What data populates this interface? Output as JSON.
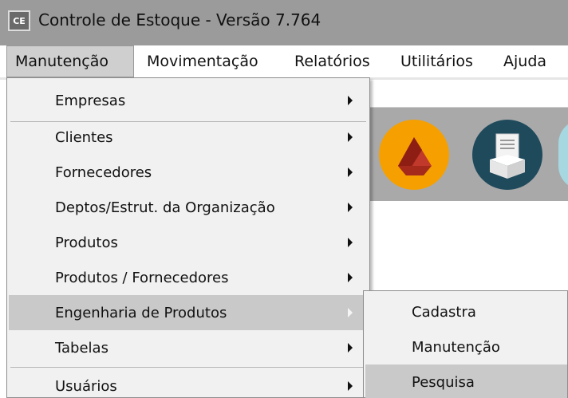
{
  "window": {
    "icon_text": "CE",
    "title": "Controle de Estoque - Versão 7.764"
  },
  "menubar": {
    "items": [
      {
        "label": "Manutenção"
      },
      {
        "label": "Movimentação"
      },
      {
        "label": "Relatórios"
      },
      {
        "label": "Utilitários"
      },
      {
        "label": "Ajuda"
      }
    ]
  },
  "dropdown": {
    "items": [
      {
        "label": "Empresas"
      },
      {
        "label": "Clientes"
      },
      {
        "label": "Fornecedores"
      },
      {
        "label": "Deptos/Estrut. da Organização"
      },
      {
        "label": "Produtos"
      },
      {
        "label": "Produtos / Fornecedores"
      },
      {
        "label": "Engenharia de Produtos"
      },
      {
        "label": "Tabelas"
      },
      {
        "label": "Usuários"
      }
    ]
  },
  "submenu": {
    "items": [
      {
        "label": "Cadastra"
      },
      {
        "label": "Manutenção"
      },
      {
        "label": "Pesquisa"
      }
    ]
  },
  "toolbar_icons": [
    "drive-icon",
    "package-document-icon",
    "partial-icon"
  ],
  "colors": {
    "titlebar": "#9b9b9b",
    "menu_bg": "#f1f1f1",
    "highlight": "#c9c9c9",
    "orange_icon": "#f5a000",
    "teal_icon": "#1f4a5c"
  }
}
